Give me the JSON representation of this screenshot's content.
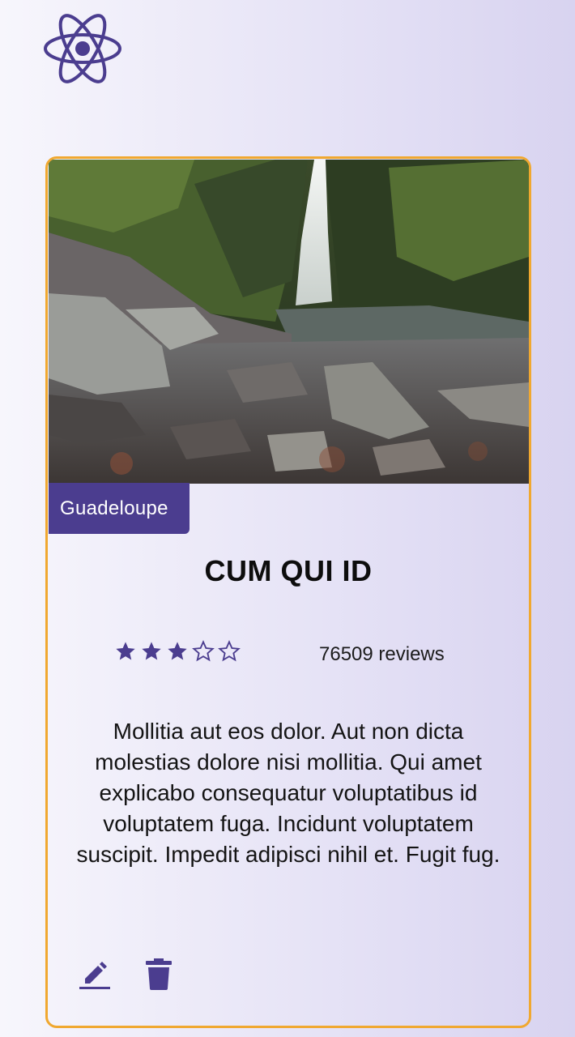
{
  "header": {
    "logo_icon": "react-atom-icon"
  },
  "card": {
    "image_alt": "Waterfall flowing into a rocky forest creek",
    "location_tag": "Guadeloupe",
    "title": "CUM QUI ID",
    "rating": {
      "value": 3,
      "max": 5
    },
    "reviews_label": "76509 reviews",
    "description": "Mollitia aut eos dolor. Aut non dicta molestias dolore nisi mollitia. Qui amet explicabo consequatur voluptatibus id voluptatem fuga. Incidunt voluptatem suscipit. Impedit adipisci nihil et. Fugit fug.",
    "actions": {
      "edit_icon": "pencil-icon",
      "delete_icon": "trash-icon"
    }
  },
  "colors": {
    "accent": "#4b3d8f",
    "card_border": "#f0a830"
  }
}
